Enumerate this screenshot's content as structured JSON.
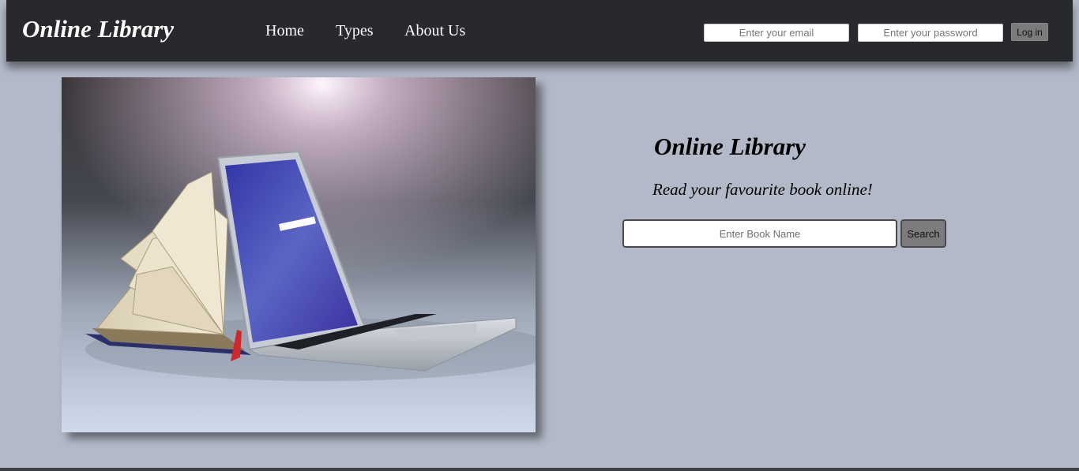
{
  "header": {
    "brand": "Online Library",
    "nav": [
      "Home",
      "Types",
      "About Us"
    ],
    "login": {
      "email_placeholder": "Enter your email",
      "password_placeholder": "Enter your password",
      "button_label": "Log in"
    }
  },
  "hero": {
    "image_alt": "Laptop emerging from an open book",
    "title": "Online Library",
    "subtitle": "Read your favourite book online!",
    "search": {
      "placeholder": "Enter Book Name",
      "button_label": "Search"
    }
  },
  "colors": {
    "navbar_bg": "#27292c",
    "page_bg": "#b3b9c8",
    "button_bg": "#7c7c7c"
  }
}
